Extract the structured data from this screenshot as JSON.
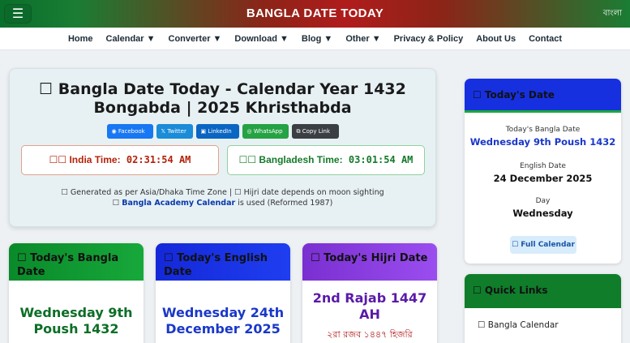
{
  "header": {
    "menu_icon": "☰",
    "site_title": "BANGLA DATE TODAY",
    "lang_toggle": "বাংলা"
  },
  "nav": {
    "items": [
      "Home",
      "Calendar ▼",
      "Converter ▼",
      "Download ▼",
      "Blog ▼",
      "Other ▼",
      "Privacy & Policy",
      "About Us",
      "Contact"
    ]
  },
  "hero": {
    "title_line1": "☐ Bangla Date Today - Calendar Year 1432",
    "title_line2": "Bongabda | 2025 Khristhabda",
    "share": {
      "facebook": "Facebook",
      "twitter": "Twitter",
      "linkedin": "LinkedIn",
      "whatsapp": "WhatsApp",
      "copy": "Copy Link"
    },
    "india_label": "☐☐ India Time:",
    "india_time": "02:31:54 AM",
    "bd_label": "☐☐ Bangladesh Time:",
    "bd_time": "03:01:54 AM",
    "info_line1": "☐ Generated as per Asia/Dhaka Time Zone   |   ☐ Hijri date depends on moon sighting",
    "info_prefix": "☐ ",
    "info_link": "Bangla Academy Calendar",
    "info_suffix": " is used (Reformed 1987)"
  },
  "cards": {
    "bangla": {
      "title": "☐ Today's Bangla Date",
      "value": "Wednesday 9th Poush 1432"
    },
    "english": {
      "title": "☐ Today's English Date",
      "value": "Wednesday 24th December 2025"
    },
    "hijri": {
      "title": "☐ Today's Hijri Date",
      "value": "2nd Rajab 1447 AH",
      "sub": "২রা রজব ১৪৪৭ হিজরি"
    }
  },
  "sidebar": {
    "today_title": "☐ Today's Date",
    "bangla_label": "Today's Bangla Date",
    "bangla_value": "Wednesday 9th Poush 1432",
    "english_label": "English Date",
    "english_value": "24 December 2025",
    "day_label": "Day",
    "day_value": "Wednesday",
    "full_cal_btn": "☐ Full Calendar",
    "quick_title": "☐ Quick Links",
    "quick_first": "☐ Bangla Calendar"
  },
  "colors": {
    "green": "#0f7d2a",
    "red": "#b01c1c",
    "blue": "#1630e0",
    "purple": "#7a2fd0"
  }
}
